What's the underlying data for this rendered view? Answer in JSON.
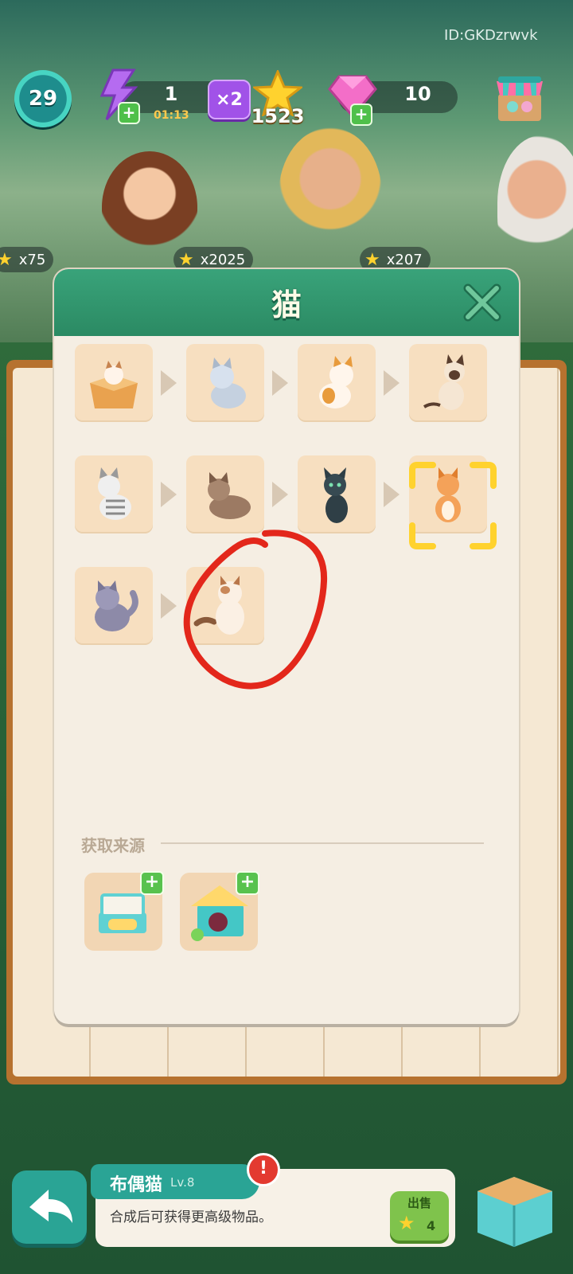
{
  "hud": {
    "player_id": "ID:GKDzrwvk",
    "level": "29",
    "energy": "1",
    "energy_timer": "01:13",
    "multiplier": "×2",
    "stars": "1523",
    "gems": "10"
  },
  "characters": {
    "badges": [
      "x75",
      "x2025",
      "x207"
    ]
  },
  "modal": {
    "title": "猫",
    "chain": [
      {
        "name": "cat-in-box"
      },
      {
        "name": "grey-kitten"
      },
      {
        "name": "calico-kitten"
      },
      {
        "name": "siamese-cat"
      },
      {
        "name": "tabby-kitten"
      },
      {
        "name": "brown-cat"
      },
      {
        "name": "black-cat"
      },
      {
        "name": "orange-cat",
        "selected": true
      },
      {
        "name": "grey-fluffy-cat"
      },
      {
        "name": "ragdoll-cat",
        "circled": true
      }
    ],
    "source_label": "获取来源",
    "sources": [
      {
        "name": "cat-bed-source"
      },
      {
        "name": "cat-house-source"
      }
    ]
  },
  "bottom": {
    "item_name": "布偶猫",
    "item_level": "Lv.8",
    "description": "合成后可获得更高级物品。",
    "sell_label": "出售",
    "sell_price": "4"
  },
  "colors": {
    "header_green": "#2b8a63",
    "modal_bg": "#f5eee3",
    "tile_bg": "#f7dfc0",
    "highlight_yellow": "#ffd22e",
    "circle_red": "#e3271b"
  }
}
